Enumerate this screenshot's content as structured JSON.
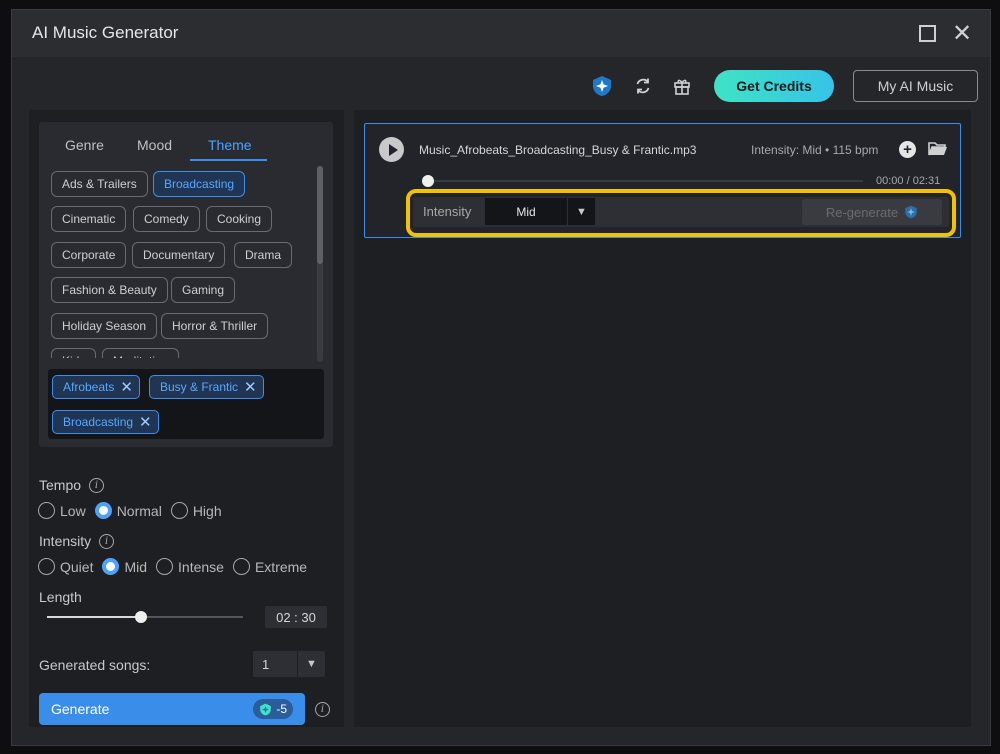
{
  "window": {
    "title": "AI Music Generator"
  },
  "toolbar": {
    "get_credits": "Get Credits",
    "my_ai_music": "My AI Music"
  },
  "tabs": [
    {
      "label": "Genre",
      "active": false
    },
    {
      "label": "Mood",
      "active": false
    },
    {
      "label": "Theme",
      "active": true
    }
  ],
  "theme_chips": [
    {
      "label": "Ads & Trailers",
      "selected": false
    },
    {
      "label": "Broadcasting",
      "selected": true
    },
    {
      "label": "Cinematic",
      "selected": false
    },
    {
      "label": "Comedy",
      "selected": false
    },
    {
      "label": "Cooking",
      "selected": false
    },
    {
      "label": "Corporate",
      "selected": false
    },
    {
      "label": "Documentary",
      "selected": false
    },
    {
      "label": "Drama",
      "selected": false
    },
    {
      "label": "Fashion & Beauty",
      "selected": false
    },
    {
      "label": "Gaming",
      "selected": false
    },
    {
      "label": "Holiday Season",
      "selected": false
    },
    {
      "label": "Horror & Thriller",
      "selected": false
    },
    {
      "label": "Kids",
      "selected": false
    },
    {
      "label": "Meditation",
      "selected": false
    }
  ],
  "selected_tags": [
    "Afrobeats",
    "Busy & Frantic",
    "Broadcasting"
  ],
  "tempo": {
    "label": "Tempo",
    "options": [
      "Low",
      "Normal",
      "High"
    ],
    "selected": "Normal"
  },
  "intensity": {
    "label": "Intensity",
    "options": [
      "Quiet",
      "Mid",
      "Intense",
      "Extreme"
    ],
    "selected": "Mid"
  },
  "length": {
    "label": "Length",
    "value": "02 : 30",
    "fraction": 0.48
  },
  "generated_songs": {
    "label": "Generated songs:",
    "value": "1"
  },
  "generate": {
    "label": "Generate",
    "cost": "-5"
  },
  "track": {
    "file_name": "Music_Afrobeats_Broadcasting_Busy & Frantic.mp3",
    "meta": "Intensity: Mid • 115 bpm",
    "time": "00:00 / 02:31",
    "intensity_label": "Intensity",
    "intensity_value": "Mid",
    "regenerate_label": "Re-generate"
  },
  "colors": {
    "accent": "#3d8ee8",
    "highlight": "#f2c200",
    "credits_gradient_start": "#3fe3c4",
    "credits_gradient_end": "#36c3e8"
  }
}
